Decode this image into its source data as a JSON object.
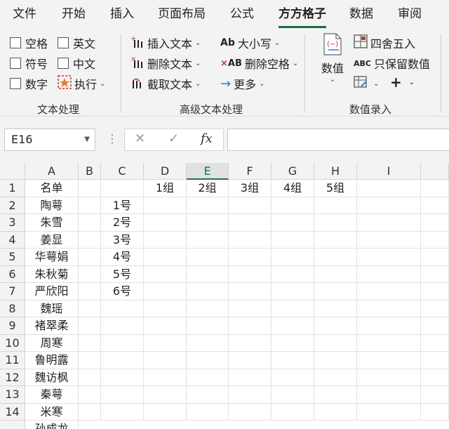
{
  "menu": {
    "tabs": [
      "文件",
      "开始",
      "插入",
      "页面布局",
      "公式",
      "方方格子",
      "数据",
      "审阅"
    ],
    "active": "方方格子"
  },
  "ribbon": {
    "text_group": {
      "label": "文本处理",
      "checkboxes": [
        "空格",
        "英文",
        "符号",
        "中文",
        "数字"
      ],
      "execute": "执行"
    },
    "advanced_group": {
      "label": "高级文本处理",
      "insert": "插入文本",
      "delete": "删除文本",
      "extract": "截取文本",
      "case": "大小写",
      "delete_space": "删除空格",
      "more": "更多"
    },
    "number_group": {
      "label": "数值录入",
      "value": "数值",
      "round": "四舍五入",
      "keep_value": "只保留数值",
      "plus": "+"
    }
  },
  "formula_bar": {
    "namebox": "E16",
    "cancel": "✕",
    "confirm": "✓",
    "fx": "fx",
    "formula": ""
  },
  "sheet": {
    "columns": [
      "A",
      "B",
      "C",
      "D",
      "E",
      "F",
      "G",
      "H",
      "I"
    ],
    "selected_column": "E",
    "rows": [
      "1",
      "2",
      "3",
      "4",
      "5",
      "6",
      "7",
      "8",
      "9",
      "10",
      "11",
      "12",
      "13",
      "14"
    ],
    "colA": [
      "名单",
      "陶萼",
      "朱雪",
      "姜显",
      "华萼娟",
      "朱秋菊",
      "严欣阳",
      "魏瑶",
      "褚翠柔",
      "周寒",
      "鲁明露",
      "魏访枫",
      "秦萼",
      "米寒"
    ],
    "colC": [
      "",
      "1号",
      "2号",
      "3号",
      "4号",
      "5号",
      "6号",
      "",
      "",
      "",
      "",
      "",
      "",
      ""
    ],
    "row1_groups": [
      "1组",
      "2组",
      "3组",
      "4组",
      "5组"
    ],
    "partial_row_text": "孙成龙"
  }
}
